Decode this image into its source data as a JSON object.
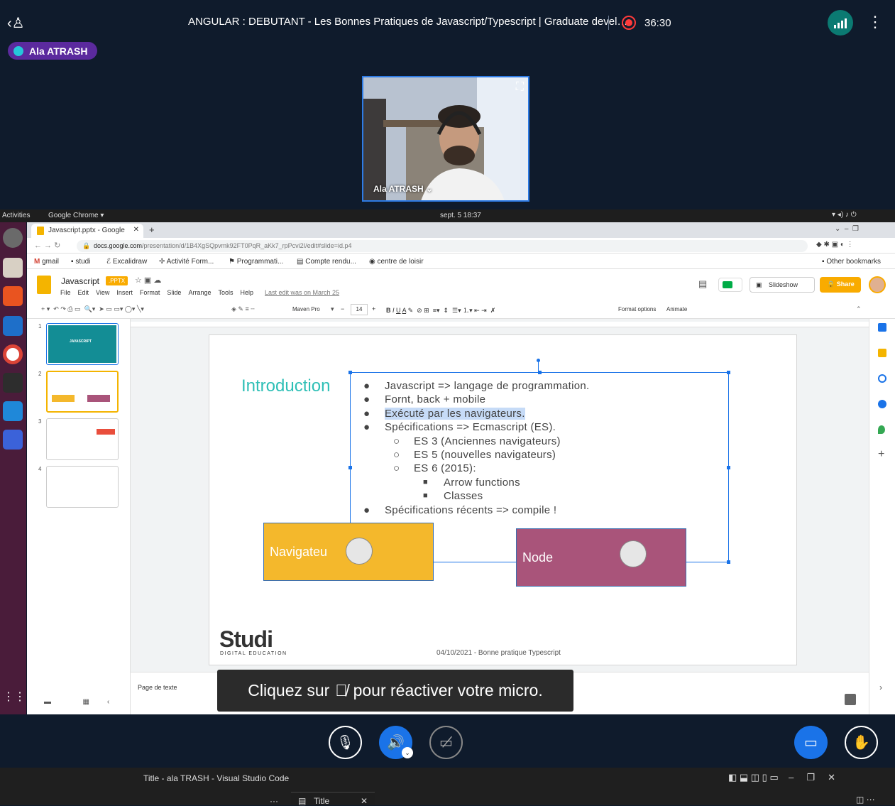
{
  "meet": {
    "title": "ANGULAR : DEBUTANT - Les Bonnes Pratiques de Javascript/Typescript | Graduate devel…",
    "record_time": "36:30",
    "speaker": "Ala ATRASH",
    "video_name": "Ala ATRASH ⌄",
    "toast_before": "Cliquez sur",
    "toast_after": "pour réactiver votre micro."
  },
  "os": {
    "activities": "Activities",
    "app": "Google Chrome ▾",
    "clock": "sept. 5  18:37"
  },
  "browser": {
    "tab_title": "Javascript.pptx - Google",
    "url_host": "docs.google.com",
    "url_path": "/presentation/d/1B4XgSQpvmk92FT0PqR_aKk7_rpPcvi2I/edit#slide=id.p4",
    "bookmarks": [
      "gmail",
      "studi",
      "Excalidraw",
      "Activité Form...",
      "Programmati...",
      "Compte rendu...",
      "centre de loisir"
    ],
    "other_bookmarks": "Other bookmarks"
  },
  "slides": {
    "doc_title": "Javascript",
    "badge": ".PPTX",
    "menus": [
      "File",
      "Edit",
      "View",
      "Insert",
      "Format",
      "Slide",
      "Arrange",
      "Tools",
      "Help"
    ],
    "last_edit": "Last edit was on March 25",
    "slideshow": "Slideshow",
    "share": "Share",
    "font": "Maven Pro",
    "font_size": "14",
    "format_options": "Format options",
    "animate": "Animate",
    "notes_placeholder": "Page de texte",
    "thumb1_title": "JAVASCRIPT",
    "thumb_numbers": [
      "1",
      "2",
      "3",
      "4"
    ]
  },
  "slide": {
    "heading": "Introduction",
    "bullets": [
      {
        "level": 1,
        "text": "Javascript => langage de programmation."
      },
      {
        "level": 1,
        "text": "Fornt, back + mobile"
      },
      {
        "level": 1,
        "text": "Exécuté par les navigateurs."
      },
      {
        "level": 1,
        "text": "Spécifications => Ecmascript (ES)."
      },
      {
        "level": 2,
        "text": "ES 3 (Anciennes navigateurs)"
      },
      {
        "level": 2,
        "text": "ES 5 (nouvelles navigateurs)"
      },
      {
        "level": 2,
        "text": "ES 6 (2015):"
      },
      {
        "level": 3,
        "text": "Arrow functions"
      },
      {
        "level": 3,
        "text": "Classes"
      },
      {
        "level": 1,
        "text": "Spécifications récents => compile !"
      }
    ],
    "box1": "Navigateu",
    "box2": "Node",
    "logo": "Studi",
    "logo_sub": "DIGITAL EDUCATION",
    "footer": "04/10/2021 - Bonne pratique Typescript"
  },
  "taskbar": {
    "window_title": "Title - ala TRASH - Visual Studio Code",
    "tab": "Title",
    "dots": "···"
  },
  "colors": {
    "meet_bg": "#0f1b2c",
    "accent_blue": "#1a73e8",
    "teal": "#2ebfb6",
    "yellow": "#f4b82c",
    "plum": "#a9547a"
  }
}
